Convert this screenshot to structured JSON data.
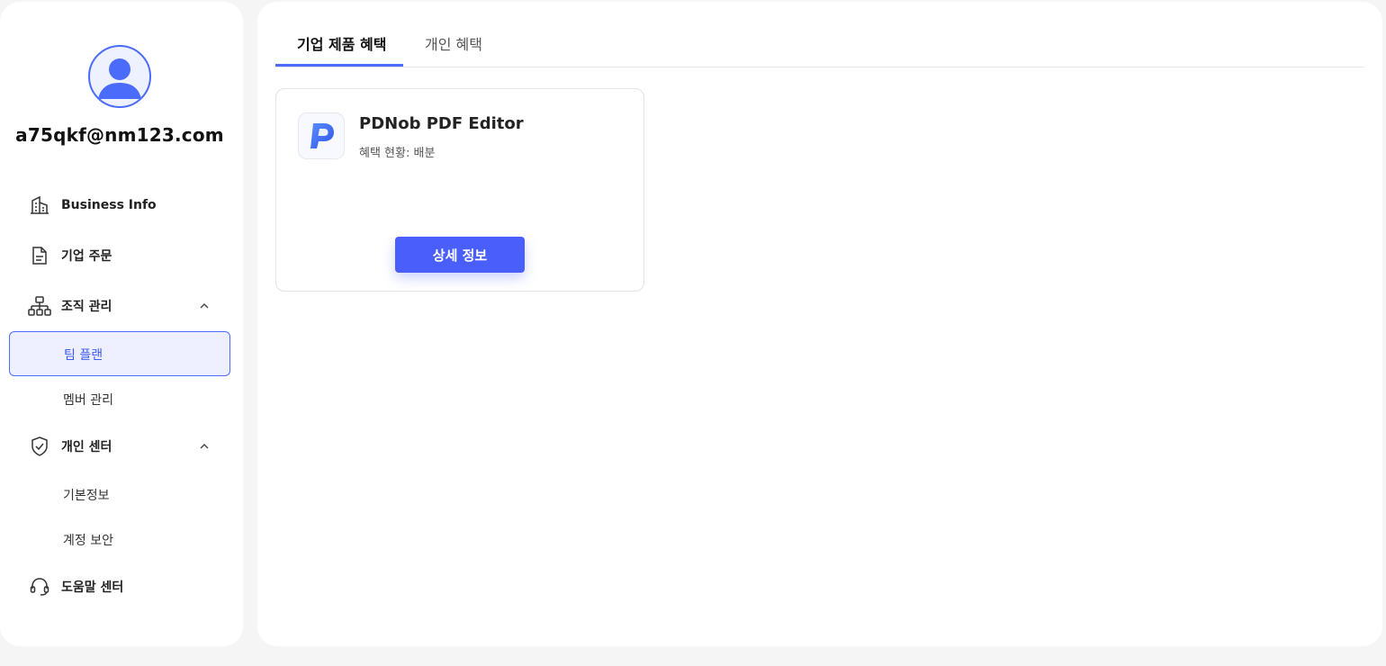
{
  "user": {
    "email": "a75qkf@nm123.com"
  },
  "sidebar": {
    "items": [
      {
        "label": "Business Info",
        "icon": "building-icon"
      },
      {
        "label": "기업 주문",
        "icon": "document-icon"
      },
      {
        "label": "조직 관리",
        "icon": "org-chart-icon",
        "expanded": true,
        "children": [
          {
            "label": "팀 플랜",
            "active": true
          },
          {
            "label": "멤버 관리"
          }
        ]
      },
      {
        "label": "개인 센터",
        "icon": "shield-check-icon",
        "expanded": true,
        "children": [
          {
            "label": "기본정보"
          },
          {
            "label": "계정 보안"
          }
        ]
      },
      {
        "label": "도움말 센터",
        "icon": "headset-icon"
      }
    ]
  },
  "main": {
    "tabs": [
      {
        "label": "기업 제품 혜택",
        "active": true
      },
      {
        "label": "개인 혜택",
        "active": false
      }
    ],
    "product": {
      "name": "PDNob PDF Editor",
      "status": "혜택 현황: 배분",
      "button_label": "상세 정보"
    }
  },
  "colors": {
    "accent": "#4b6bfb",
    "button": "#4a5efc",
    "active_bg": "#eef0ff"
  }
}
